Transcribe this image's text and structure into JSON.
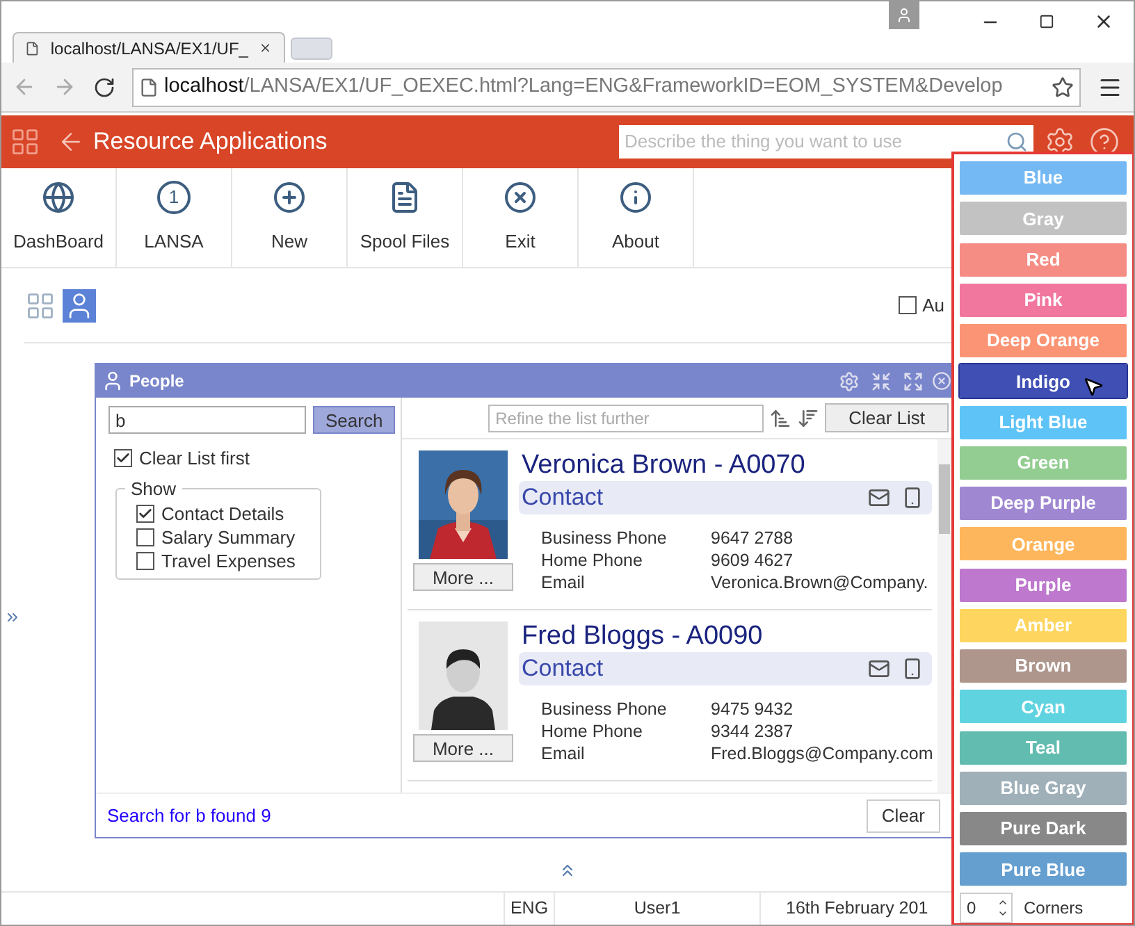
{
  "browser": {
    "tab_title": "localhost/LANSA/EX1/UF_",
    "url_host": "localhost",
    "url_path": "/LANSA/EX1/UF_OEXEC.html?Lang=ENG&FrameworkID=EOM_SYSTEM&Develop"
  },
  "app": {
    "title": "Resource Applications",
    "search": {
      "placeholder": "Describe the thing you want to use"
    }
  },
  "toolbar": [
    {
      "kind": "globe",
      "label": "DashBoard"
    },
    {
      "kind": "number",
      "badge": "1",
      "label": "LANSA"
    },
    {
      "kind": "plus",
      "label": "New"
    },
    {
      "kind": "list",
      "label": "Spool Files"
    },
    {
      "kind": "close",
      "label": "Exit"
    },
    {
      "kind": "info",
      "label": "About"
    }
  ],
  "views": [
    {
      "kind": "grid",
      "selected": false
    },
    {
      "kind": "person",
      "selected": true
    }
  ],
  "auto_checkbox": {
    "label": "Au",
    "checked": false
  },
  "panel": {
    "title": "People",
    "search_value": "b",
    "search_button": "Search",
    "clear_first": {
      "label": "Clear List first",
      "checked": true
    },
    "show": {
      "legend": "Show",
      "options": [
        {
          "label": "Contact Details",
          "checked": true
        },
        {
          "label": "Salary Summary",
          "checked": false
        },
        {
          "label": "Travel Expenses",
          "checked": false
        }
      ]
    },
    "refine": {
      "placeholder": "Refine the list further"
    },
    "clear_list_button": "Clear List",
    "cards": [
      {
        "kind": "picture",
        "more": "More ...",
        "name": "Veronica Brown - A0070",
        "section": "Contact",
        "fields": [
          {
            "label": "Business Phone",
            "value": "9647 2788"
          },
          {
            "label": "Home Phone",
            "value": "9609 4627"
          },
          {
            "label": "Email",
            "value": "Veronica.Brown@Company."
          }
        ]
      },
      {
        "kind": "silhouette",
        "more": "More ...",
        "name": "Fred Bloggs - A0090",
        "section": "Contact",
        "fields": [
          {
            "label": "Business Phone",
            "value": "9475 9432"
          },
          {
            "label": "Home Phone",
            "value": "9344 2387"
          },
          {
            "label": "Email",
            "value": "Fred.Bloggs@Company.com"
          }
        ]
      }
    ],
    "status": "Search for b found 9",
    "clear_button": "Clear"
  },
  "colors": [
    {
      "label": "Blue",
      "color": "#74b9f4",
      "hovered": false
    },
    {
      "label": "Gray",
      "color": "#c2c2c2",
      "hovered": false
    },
    {
      "label": "Red",
      "color": "#f58d85",
      "hovered": false
    },
    {
      "label": "Pink",
      "color": "#f1779f",
      "hovered": false
    },
    {
      "label": "Deep Orange",
      "color": "#fb9474",
      "hovered": false
    },
    {
      "label": "Indigo",
      "color": "#3f4fb4",
      "hovered": true
    },
    {
      "label": "Light Blue",
      "color": "#5ec4f7",
      "hovered": false
    },
    {
      "label": "Green",
      "color": "#93cd92",
      "hovered": false
    },
    {
      "label": "Deep Purple",
      "color": "#9f88d1",
      "hovered": false
    },
    {
      "label": "Orange",
      "color": "#feb65c",
      "hovered": false
    },
    {
      "label": "Purple",
      "color": "#be78cd",
      "hovered": false
    },
    {
      "label": "Amber",
      "color": "#fed65f",
      "hovered": false
    },
    {
      "label": "Brown",
      "color": "#ae968d",
      "hovered": false
    },
    {
      "label": "Cyan",
      "color": "#60d3e1",
      "hovered": false
    },
    {
      "label": "Teal",
      "color": "#62bcb0",
      "hovered": false
    },
    {
      "label": "Blue Gray",
      "color": "#9fb0b9",
      "hovered": false
    },
    {
      "label": "Pure Dark",
      "color": "#888888",
      "hovered": false
    },
    {
      "label": "Pure Blue",
      "color": "#659fd0",
      "hovered": false
    }
  ],
  "corners": {
    "value": "0",
    "label": "Corners"
  },
  "status_bar": [
    "ENG",
    "User1",
    "16th February 201"
  ]
}
